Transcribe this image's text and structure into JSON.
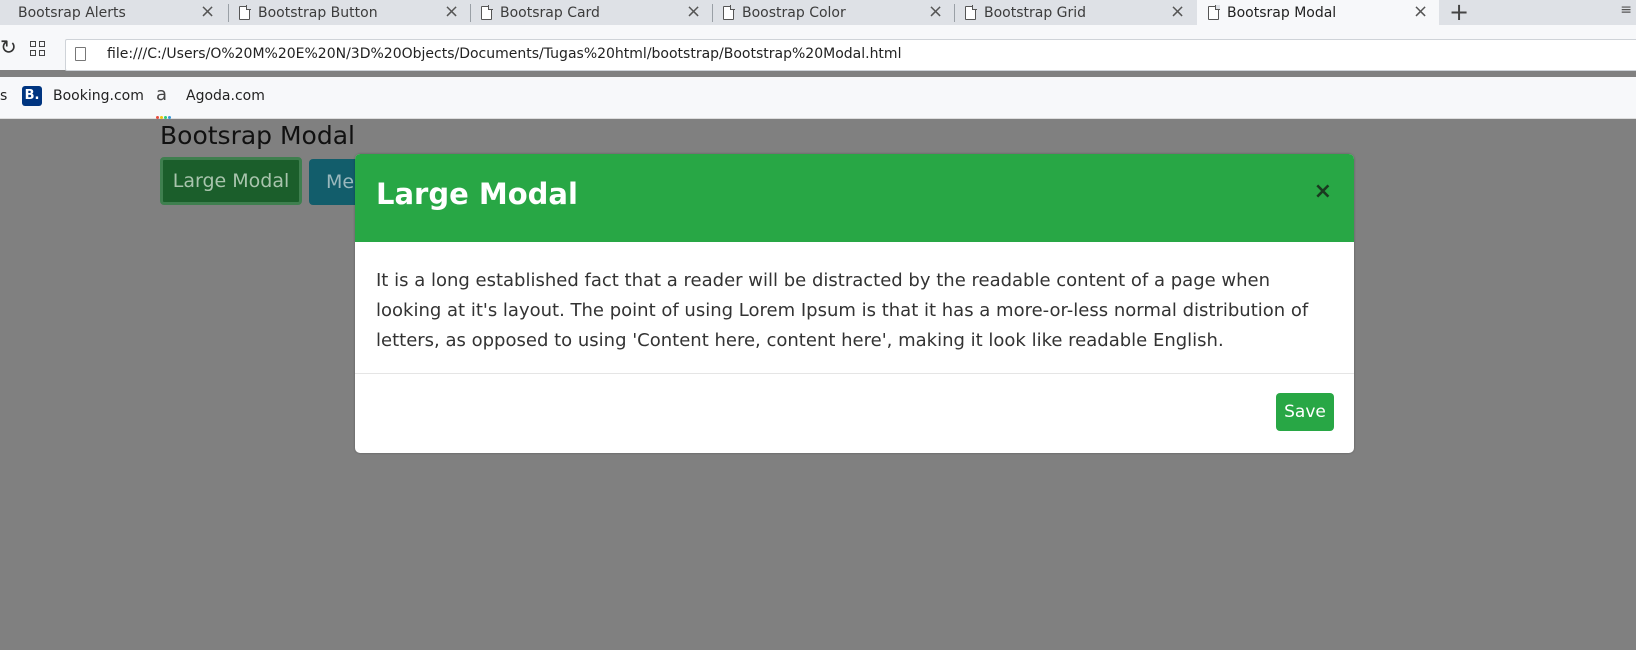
{
  "browser": {
    "tabs": [
      {
        "title": "Bootsrap Alerts"
      },
      {
        "title": "Bootstrap Button"
      },
      {
        "title": "Bootsrap Card"
      },
      {
        "title": "Boostrap Color"
      },
      {
        "title": "Bootstrap Grid"
      },
      {
        "title": "Bootsrap Modal"
      }
    ],
    "active_tab_index": 5,
    "url": "file:///C:/Users/O%20M%20E%20N/3D%20Objects/Documents/Tugas%20html/bootstrap/Bootstrap%20Modal.html",
    "bookmarks": {
      "partial": "s",
      "booking_icon": "B.",
      "booking": "Booking.com",
      "agoda_icon": "a",
      "agoda": "Agoda.com"
    }
  },
  "page": {
    "heading": "Bootsrap Modal",
    "large_modal_button": "Large Modal",
    "medium_modal_button_partial": "Me"
  },
  "modal": {
    "title": "Large Modal",
    "close_glyph": "×",
    "body_text": "It is a long established fact that a reader will be distracted by the readable content of a page when looking at it's layout. The point of using Lorem Ipsum is that it has a more-or-less normal distribution of letters, as opposed to using 'Content here, content here', making it look like readable English.",
    "save_button": "Save",
    "header_color": "#28a745"
  },
  "colors": {
    "backdrop": "#808080",
    "success": "#28a745"
  }
}
